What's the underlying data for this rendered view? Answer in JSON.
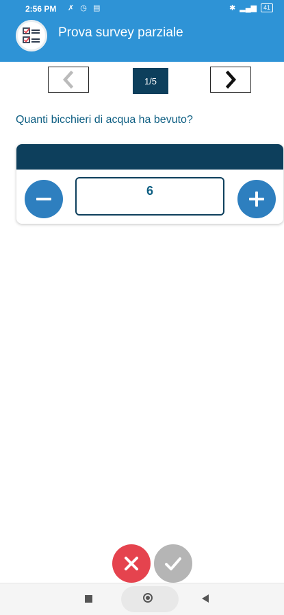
{
  "status_bar": {
    "time": "2:56 PM",
    "icons": [
      "vibrate-off-icon",
      "alarm-icon",
      "notification-icon"
    ],
    "right_icons": [
      "bluetooth-icon",
      "signal-icon"
    ],
    "battery": "41"
  },
  "app_bar": {
    "title": "Prova survey parziale",
    "logo": "survey-checklist-icon"
  },
  "navigation": {
    "prev_icon": "chevron-left-icon",
    "page_indicator": "1/5",
    "next_icon": "chevron-right-icon"
  },
  "question": {
    "text": "Quanti bicchieri di acqua ha bevuto?"
  },
  "stepper": {
    "value": "6",
    "minus_icon": "minus-icon",
    "plus_icon": "plus-icon"
  },
  "actions": {
    "cancel_icon": "close-icon",
    "confirm_icon": "checkmark-icon"
  },
  "colors": {
    "primary": "#2E93D6",
    "dark": "#0D3F5C",
    "cancel": "#E5434E",
    "confirm_disabled": "#B5B5B5"
  }
}
